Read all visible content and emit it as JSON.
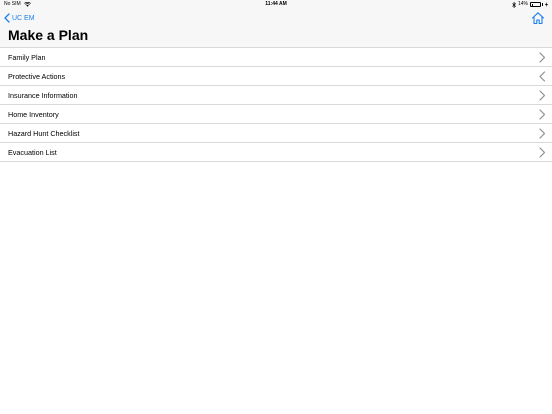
{
  "status_bar": {
    "carrier": "No SIM",
    "time": "11:44 AM",
    "battery": "14%",
    "battery_level": 0.14
  },
  "nav": {
    "back_label": "UC EM",
    "title": "Make a Plan",
    "home_icon": "home-icon"
  },
  "list": {
    "items": [
      {
        "label": "Family Plan",
        "chevron": "right"
      },
      {
        "label": "Protective Actions",
        "chevron": "left"
      },
      {
        "label": "Insurance Information",
        "chevron": "right"
      },
      {
        "label": "Home Inventory",
        "chevron": "right"
      },
      {
        "label": "Hazard Hunt Checklist",
        "chevron": "right"
      },
      {
        "label": "Evacuation List",
        "chevron": "right"
      }
    ]
  },
  "colors": {
    "accent": "#1b7ff0",
    "chevron": "#8e8e93",
    "separator": "#d9d9d9",
    "header_bg": "#f7f7f7"
  }
}
